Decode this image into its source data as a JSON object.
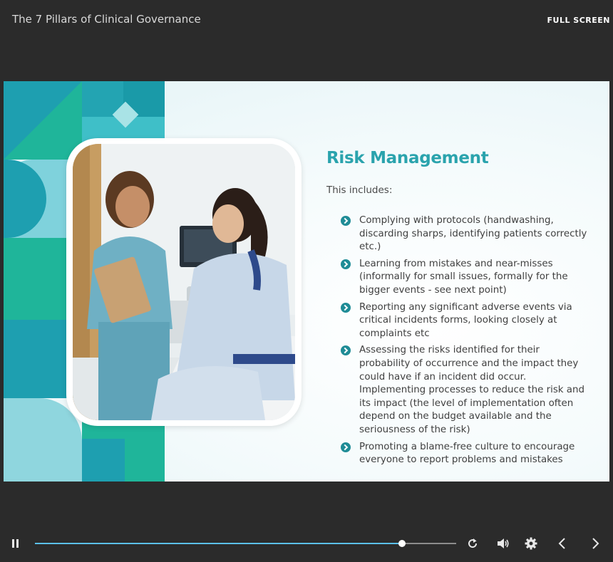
{
  "header": {
    "course_title": "The 7 Pillars of Clinical Governance",
    "full_screen_label": "FULL SCREEN"
  },
  "slide": {
    "heading": "Risk Management",
    "intro": "This includes:",
    "bullets": [
      "Complying with protocols (handwashing, discarding sharps, identifying patients correctly etc.)",
      "Learning from mistakes and near-misses (informally for small issues, formally for the bigger events - see next point)",
      "Reporting any significant adverse events via critical incidents forms, looking closely at complaints etc",
      "Assessing the risks identified for their probability of occurrence and the impact they could have if an incident did occur. Implementing processes to reduce the risk and its impact (the level of implementation often depend on the budget available and the seriousness of the risk)",
      "Promoting a blame-free culture to encourage everyone to report problems and mistakes"
    ],
    "image": "nurse-with-patient-photo"
  },
  "player": {
    "progress_fraction": 0.872,
    "controls": [
      "pause-icon",
      "replay-icon",
      "volume-icon",
      "settings-icon",
      "previous-icon",
      "next-icon"
    ]
  },
  "colors": {
    "accent": "#2aa3ad",
    "progress": "#5bc0ea",
    "background": "#2b2b2b"
  }
}
